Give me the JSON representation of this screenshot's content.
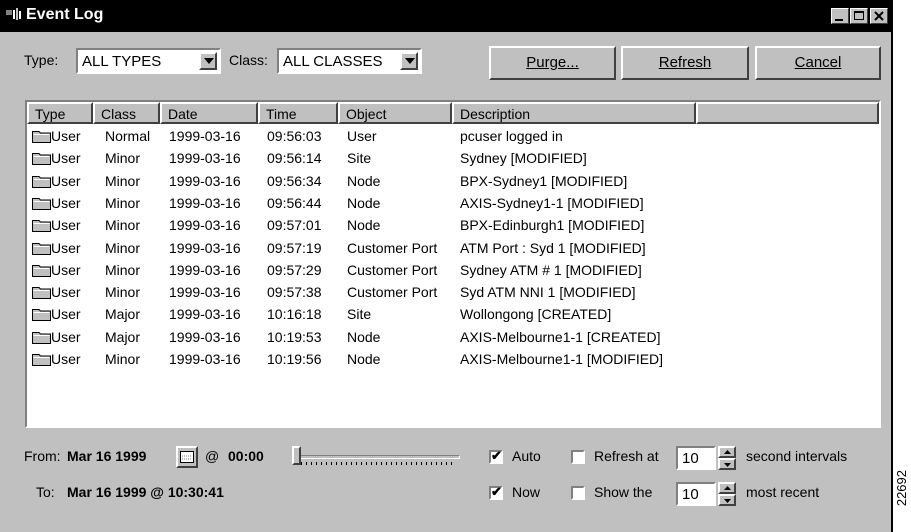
{
  "window": {
    "title": "Event Log",
    "side_label": "22692"
  },
  "filters": {
    "type_label": "Type:",
    "type_value": "ALL TYPES",
    "class_label": "Class:",
    "class_value": "ALL CLASSES"
  },
  "buttons": {
    "purge": "Purge...",
    "refresh": "Refresh",
    "cancel": "Cancel"
  },
  "table": {
    "headers": [
      "Type",
      "Class",
      "Date",
      "Time",
      "Object",
      "Description"
    ],
    "rows": [
      [
        "User",
        "Normal",
        "1999-03-16",
        "09:56:03",
        "User",
        "pcuser logged in"
      ],
      [
        "User",
        "Minor",
        "1999-03-16",
        "09:56:14",
        "Site",
        "Sydney [MODIFIED]"
      ],
      [
        "User",
        "Minor",
        "1999-03-16",
        "09:56:34",
        "Node",
        "BPX-Sydney1 [MODIFIED]"
      ],
      [
        "User",
        "Minor",
        "1999-03-16",
        "09:56:44",
        "Node",
        "AXIS-Sydney1-1 [MODIFIED]"
      ],
      [
        "User",
        "Minor",
        "1999-03-16",
        "09:57:01",
        "Node",
        "BPX-Edinburgh1 [MODIFIED]"
      ],
      [
        "User",
        "Minor",
        "1999-03-16",
        "09:57:19",
        "Customer Port",
        "ATM Port : Syd 1 [MODIFIED]"
      ],
      [
        "User",
        "Minor",
        "1999-03-16",
        "09:57:29",
        "Customer Port",
        "Sydney ATM # 1 [MODIFIED]"
      ],
      [
        "User",
        "Minor",
        "1999-03-16",
        "09:57:38",
        "Customer Port",
        "Syd ATM NNI 1 [MODIFIED]"
      ],
      [
        "User",
        "Major",
        "1999-03-16",
        "10:16:18",
        "Site",
        "Wollongong [CREATED]"
      ],
      [
        "User",
        "Major",
        "1999-03-16",
        "10:19:53",
        "Node",
        "AXIS-Melbourne1-1 [CREATED]"
      ],
      [
        "User",
        "Minor",
        "1999-03-16",
        "10:19:56",
        "Node",
        "AXIS-Melbourne1-1 [MODIFIED]"
      ]
    ]
  },
  "range": {
    "from_label": "From:",
    "from_date": "Mar 16 1999",
    "at": "@",
    "from_time": "00:00",
    "to_label": "To:",
    "to_value": "Mar 16 1999 @ 10:30:41",
    "slider_position": 0
  },
  "options": {
    "auto_label": "Auto",
    "auto_checked": true,
    "now_label": "Now",
    "now_checked": true,
    "refresh_at_label": "Refresh at",
    "refresh_at_checked": false,
    "refresh_value": "10",
    "refresh_suffix": "second intervals",
    "show_the_label": "Show the",
    "show_the_checked": false,
    "show_value": "10",
    "show_suffix": "most recent"
  }
}
